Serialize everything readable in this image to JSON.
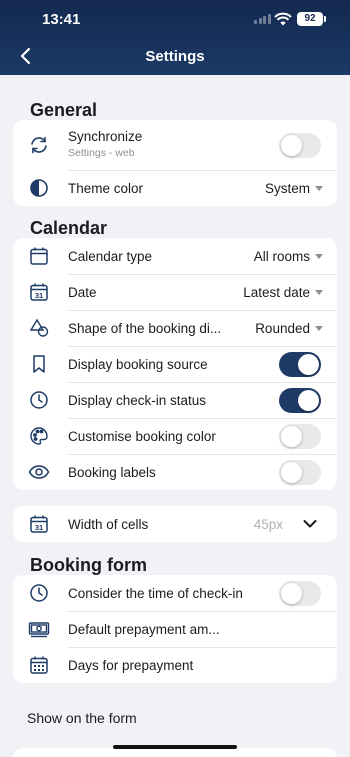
{
  "status_bar": {
    "time": "13:41",
    "battery": "92"
  },
  "header": {
    "title": "Settings"
  },
  "general": {
    "title": "General",
    "sync_label": "Synchronize",
    "sync_sub": "Settings - web",
    "sync_on": false,
    "theme_label": "Theme color",
    "theme_value": "System"
  },
  "calendar": {
    "title": "Calendar",
    "type_label": "Calendar type",
    "type_value": "All rooms",
    "date_label": "Date",
    "date_value": "Latest date",
    "date_icon_num": "31",
    "shape_label": "Shape of the booking di...",
    "shape_value": "Rounded",
    "source_label": "Display booking source",
    "source_on": true,
    "checkin_label": "Display check-in status",
    "checkin_on": true,
    "color_label": "Customise booking color",
    "color_on": false,
    "labels_label": "Booking labels",
    "labels_on": false
  },
  "cells": {
    "label": "Width of cells",
    "value": "45px",
    "icon_num": "31"
  },
  "booking_form": {
    "title": "Booking form",
    "consider_label": "Consider the time of check-in",
    "consider_on": false,
    "prepay_amount_label": "Default prepayment am...",
    "prepay_days_label": "Days for prepayment"
  },
  "show_on_form": {
    "label": "Show on the form"
  },
  "colors": {
    "accent": "#1e3a66",
    "header": "#13294f",
    "background": "#f1f1f6"
  }
}
